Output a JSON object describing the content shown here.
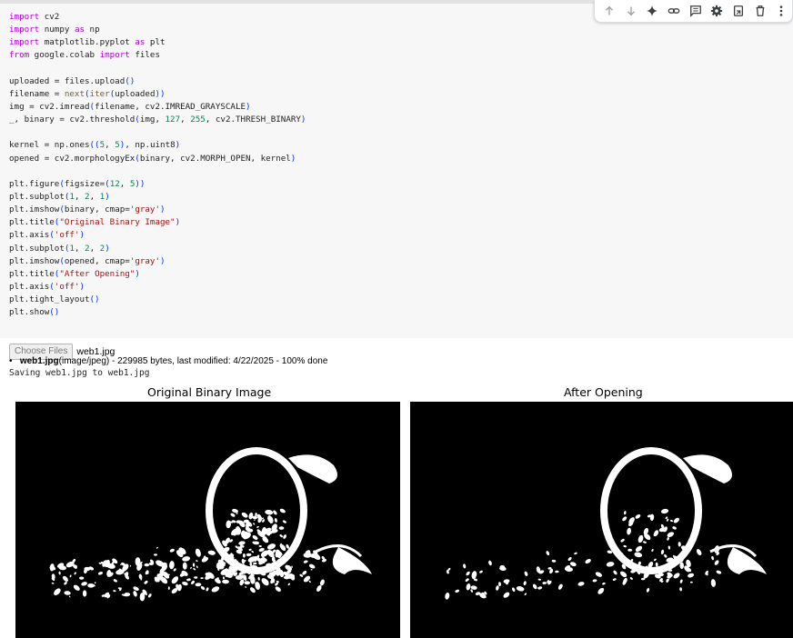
{
  "code_lines": [
    [
      [
        "kw",
        "import"
      ],
      [
        "t",
        " cv2"
      ]
    ],
    [
      [
        "kw",
        "import"
      ],
      [
        "t",
        " numpy "
      ],
      [
        "kw",
        "as"
      ],
      [
        "t",
        " np"
      ]
    ],
    [
      [
        "kw",
        "import"
      ],
      [
        "t",
        " matplotlib.pyplot "
      ],
      [
        "kw",
        "as"
      ],
      [
        "t",
        " plt"
      ]
    ],
    [
      [
        "kw",
        "from"
      ],
      [
        "t",
        " google.colab "
      ],
      [
        "kw",
        "import"
      ],
      [
        "t",
        " files"
      ]
    ],
    [],
    [
      [
        "t",
        "uploaded = files.upload"
      ],
      [
        "par",
        "()"
      ]
    ],
    [
      [
        "t",
        "filename = "
      ],
      [
        "fn",
        "next"
      ],
      [
        "par",
        "("
      ],
      [
        "fn",
        "iter"
      ],
      [
        "par",
        "("
      ],
      [
        "t",
        "uploaded"
      ],
      [
        "par",
        "))"
      ]
    ],
    [
      [
        "t",
        "img = cv2.imread"
      ],
      [
        "par",
        "("
      ],
      [
        "t",
        "filename, cv2.IMREAD_GRAYSCALE"
      ],
      [
        "par",
        ")"
      ]
    ],
    [
      [
        "t",
        "_, binary = cv2.threshold"
      ],
      [
        "par",
        "("
      ],
      [
        "t",
        "img, "
      ],
      [
        "num",
        "127"
      ],
      [
        "t",
        ", "
      ],
      [
        "num",
        "255"
      ],
      [
        "t",
        ", cv2.THRESH_BINARY"
      ],
      [
        "par",
        ")"
      ]
    ],
    [],
    [
      [
        "t",
        "kernel = np.ones"
      ],
      [
        "par",
        "(("
      ],
      [
        "num",
        "5"
      ],
      [
        "t",
        ", "
      ],
      [
        "num",
        "5"
      ],
      [
        "par",
        ")"
      ],
      [
        "t",
        ", np.uint8"
      ],
      [
        "par",
        ")"
      ]
    ],
    [
      [
        "t",
        "opened = cv2.morphologyEx"
      ],
      [
        "par",
        "("
      ],
      [
        "t",
        "binary, cv2.MORPH_OPEN, kernel"
      ],
      [
        "par",
        ")"
      ]
    ],
    [],
    [
      [
        "t",
        "plt.figure"
      ],
      [
        "par",
        "("
      ],
      [
        "t",
        "figsize="
      ],
      [
        "par",
        "("
      ],
      [
        "num",
        "12"
      ],
      [
        "t",
        ", "
      ],
      [
        "num",
        "5"
      ],
      [
        "par",
        "))"
      ]
    ],
    [
      [
        "t",
        "plt.subplot"
      ],
      [
        "par",
        "("
      ],
      [
        "num",
        "1"
      ],
      [
        "t",
        ", "
      ],
      [
        "num",
        "2"
      ],
      [
        "t",
        ", "
      ],
      [
        "num",
        "1"
      ],
      [
        "par",
        ")"
      ]
    ],
    [
      [
        "t",
        "plt.imshow"
      ],
      [
        "par",
        "("
      ],
      [
        "t",
        "binary, cmap="
      ],
      [
        "str",
        "'gray'"
      ],
      [
        "par",
        ")"
      ]
    ],
    [
      [
        "t",
        "plt.title"
      ],
      [
        "par",
        "("
      ],
      [
        "str",
        "\"Original Binary Image\""
      ],
      [
        "par",
        ")"
      ]
    ],
    [
      [
        "t",
        "plt.axis"
      ],
      [
        "par",
        "("
      ],
      [
        "str",
        "'off'"
      ],
      [
        "par",
        ")"
      ]
    ],
    [
      [
        "t",
        "plt.subplot"
      ],
      [
        "par",
        "("
      ],
      [
        "num",
        "1"
      ],
      [
        "t",
        ", "
      ],
      [
        "num",
        "2"
      ],
      [
        "t",
        ", "
      ],
      [
        "num",
        "2"
      ],
      [
        "par",
        ")"
      ]
    ],
    [
      [
        "t",
        "plt.imshow"
      ],
      [
        "par",
        "("
      ],
      [
        "t",
        "opened, cmap="
      ],
      [
        "str",
        "'gray'"
      ],
      [
        "par",
        ")"
      ]
    ],
    [
      [
        "t",
        "plt.title"
      ],
      [
        "par",
        "("
      ],
      [
        "str",
        "\"After Opening\""
      ],
      [
        "par",
        ")"
      ]
    ],
    [
      [
        "t",
        "plt.axis"
      ],
      [
        "par",
        "("
      ],
      [
        "str",
        "'off'"
      ],
      [
        "par",
        ")"
      ]
    ],
    [
      [
        "t",
        "plt.tight_layout"
      ],
      [
        "par",
        "()"
      ]
    ],
    [
      [
        "t",
        "plt.show"
      ],
      [
        "par",
        "()"
      ]
    ]
  ],
  "toolbar": {
    "icons": [
      "arrow-up-icon",
      "arrow-down-icon",
      "sparkle-icon",
      "link-icon",
      "comment-icon",
      "gear-icon",
      "mirror-cell-icon",
      "trash-icon",
      "more-vert-icon"
    ]
  },
  "output": {
    "choose_button": "Choose Files",
    "chosen_file": "web1.jpg",
    "file_name": "web1.jpg",
    "file_details": "(image/jpeg) - 229985 bytes, last modified: 4/22/2025 - 100% done",
    "saving_text": "Saving web1.jpg to web1.jpg",
    "plot1_title": "Original Binary Image",
    "plot2_title": "After Opening"
  }
}
